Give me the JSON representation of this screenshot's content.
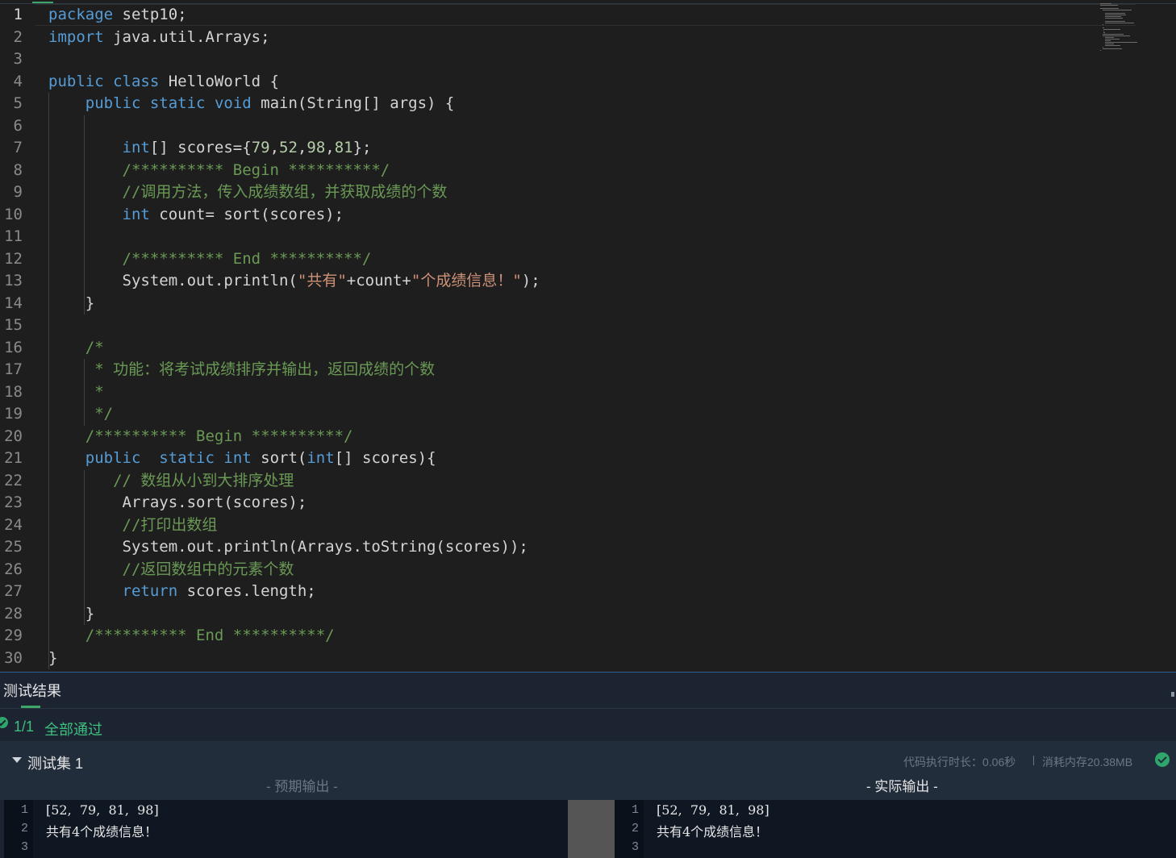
{
  "editor": {
    "lines": [
      [
        [
          "kw",
          "package"
        ],
        [
          "t",
          " setp10;"
        ]
      ],
      [
        [
          "kw",
          "import"
        ],
        [
          "t",
          " java.util.Arrays;"
        ]
      ],
      [],
      [
        [
          "kw",
          "public"
        ],
        [
          "t",
          " "
        ],
        [
          "kw",
          "class"
        ],
        [
          "t",
          " HelloWorld {"
        ]
      ],
      [
        [
          "t",
          "    "
        ],
        [
          "kw",
          "public"
        ],
        [
          "t",
          " "
        ],
        [
          "kw",
          "static"
        ],
        [
          "t",
          " "
        ],
        [
          "kw",
          "void"
        ],
        [
          "t",
          " main(String[] args) {"
        ]
      ],
      [],
      [
        [
          "t",
          "        "
        ],
        [
          "kw",
          "int"
        ],
        [
          "t",
          "[] scores={"
        ],
        [
          "num",
          "79"
        ],
        [
          "t",
          ","
        ],
        [
          "num",
          "52"
        ],
        [
          "t",
          ","
        ],
        [
          "num",
          "98"
        ],
        [
          "t",
          ","
        ],
        [
          "num",
          "81"
        ],
        [
          "t",
          "};"
        ]
      ],
      [
        [
          "t",
          "        "
        ],
        [
          "cm",
          "/********** Begin **********/"
        ]
      ],
      [
        [
          "t",
          "        "
        ],
        [
          "cm",
          "//"
        ],
        [
          "cmc",
          "调用方法，传入成绩数组，并获取成绩的个数"
        ]
      ],
      [
        [
          "t",
          "        "
        ],
        [
          "kw",
          "int"
        ],
        [
          "t",
          " count= sort(scores);"
        ]
      ],
      [],
      [
        [
          "t",
          "        "
        ],
        [
          "cm",
          "/********** End **********/"
        ]
      ],
      [
        [
          "t",
          "        System.out.println("
        ],
        [
          "str",
          "\""
        ],
        [
          "strc",
          "共有"
        ],
        [
          "str",
          "\""
        ],
        [
          "t",
          "+count+"
        ],
        [
          "str",
          "\""
        ],
        [
          "strc",
          "个成绩信息！"
        ],
        [
          "str",
          "\""
        ],
        [
          "t",
          ");"
        ]
      ],
      [
        [
          "t",
          "    }"
        ]
      ],
      [],
      [
        [
          "t",
          "    "
        ],
        [
          "cm",
          "/*"
        ]
      ],
      [
        [
          "t",
          "     "
        ],
        [
          "cm",
          "* "
        ],
        [
          "cmc",
          "功能：将考试成绩排序并输出，返回成绩的个数"
        ]
      ],
      [
        [
          "t",
          "     "
        ],
        [
          "cm",
          "*"
        ]
      ],
      [
        [
          "t",
          "     "
        ],
        [
          "cm",
          "*/"
        ]
      ],
      [
        [
          "t",
          "    "
        ],
        [
          "cm",
          "/********** Begin **********/"
        ]
      ],
      [
        [
          "t",
          "    "
        ],
        [
          "kw",
          "public"
        ],
        [
          "t",
          "  "
        ],
        [
          "kw",
          "static"
        ],
        [
          "t",
          " "
        ],
        [
          "kw",
          "int"
        ],
        [
          "t",
          " sort("
        ],
        [
          "kw",
          "int"
        ],
        [
          "t",
          "[] scores){"
        ]
      ],
      [
        [
          "t",
          "       "
        ],
        [
          "cm",
          "// "
        ],
        [
          "cmc",
          "数组从小到大排序处理"
        ]
      ],
      [
        [
          "t",
          "        Arrays.sort(scores);"
        ]
      ],
      [
        [
          "t",
          "        "
        ],
        [
          "cm",
          "//"
        ],
        [
          "cmc",
          "打印出数组"
        ]
      ],
      [
        [
          "t",
          "        System.out.println(Arrays.toString(scores));"
        ]
      ],
      [
        [
          "t",
          "        "
        ],
        [
          "cm",
          "//"
        ],
        [
          "cmc",
          "返回数组中的元素个数"
        ]
      ],
      [
        [
          "t",
          "        "
        ],
        [
          "kw",
          "return"
        ],
        [
          "t",
          " scores.length;"
        ]
      ],
      [
        [
          "t",
          "    }"
        ]
      ],
      [
        [
          "t",
          "    "
        ],
        [
          "cm",
          "/********** End **********/"
        ]
      ],
      [
        [
          "t",
          "}"
        ]
      ]
    ],
    "colors": {
      "keyword": "#569cd6",
      "number": "#b5cea8",
      "comment": "#6a9955",
      "string": "#ce9178",
      "text": "#d4d4d4"
    }
  },
  "results": {
    "title": "测试结果",
    "summary_count": "1/1",
    "summary_text": "全部通过",
    "testset_name": "测试集 1",
    "exec_time": "代码执行时长：0.06秒",
    "exec_memory": "消耗内存20.38MB",
    "expected_title": "- 预期输出 -",
    "actual_title": "- 实际输出 -",
    "expected_lines": [
      "[52,  79,  81,  98]",
      "共有4个成绩信息！",
      ""
    ],
    "actual_lines": [
      "[52,  79,  81,  98]",
      "共有4个成绩信息！",
      ""
    ],
    "pass_color": "#3fbf7f"
  }
}
